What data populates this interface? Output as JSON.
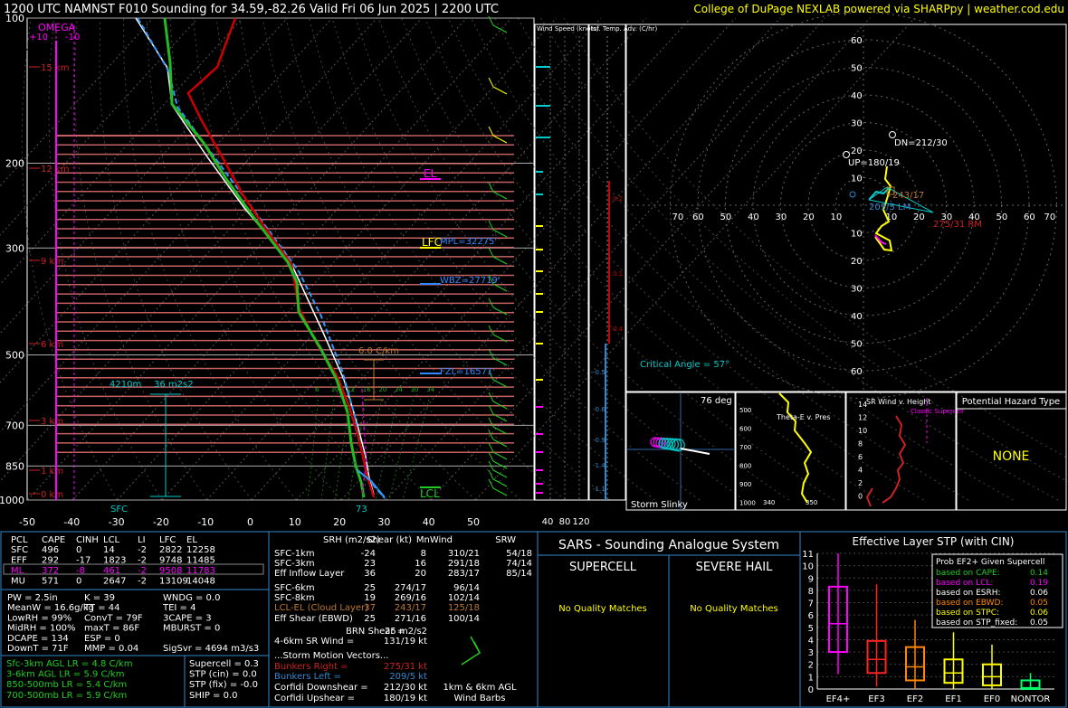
{
  "header": {
    "title": "1200 UTC NAMNST F010 Sounding for 34.59,-82.26 Valid  Fri 06 Jun 2025 | 2200 UTC",
    "credit": "College of DuPage NEXLAB powered via SHARPpy | weather.cod.edu"
  },
  "colors": {
    "bg": "#000000",
    "temp": "#cc0000",
    "dewpoint": "#22bb22",
    "wetbulb": "#00bbff",
    "parcel": "#ffffff",
    "dry_adiabat": "#888888",
    "moist_adiabat": "#22aa22",
    "mixing_ratio": "#22aa22",
    "cape_shade": "#e87070",
    "wind_barb": "#22cc22",
    "accent_cyan": "#00cccc",
    "magenta": "#ff00ff",
    "yellow": "#ffff00",
    "border": "#3388cc"
  },
  "skewt": {
    "omega_label": "OMEGA",
    "omega_ticks": [
      "+10",
      "-10"
    ],
    "pressure_ticks": [
      "100",
      "200",
      "300",
      "500",
      "700",
      "850",
      "1000"
    ],
    "temp_ticks": [
      "-50",
      "-40",
      "-30",
      "-20",
      "-10",
      "0",
      "10",
      "20",
      "30",
      "40",
      "50"
    ],
    "height_labels": [
      "15 km",
      "12 km",
      "9 km",
      "6 km",
      "3 km",
      "1 km",
      "0 km"
    ],
    "el_label": "EL",
    "lfc_label": "LFC",
    "lcl_label": "LCL",
    "mpl_label": "MPL=32275'",
    "wbz_label": "WBZ=27719'",
    "frz_label": "FZL=16571'",
    "lapse_label": "6.0 C/km",
    "dcape_label": "4210m",
    "srh_label": "36 m2s2",
    "sfc_label": "SFC",
    "sfc_temp_label": "73",
    "mixing_labels": [
      "6",
      "10",
      "12",
      "16",
      "20",
      "24",
      "30",
      "34"
    ]
  },
  "wind_speed_panel": {
    "title": "Wind Speed (knots)",
    "ticks": [
      "40",
      "80",
      "120"
    ]
  },
  "inf_temp_panel": {
    "title": "Inf. Temp. Adv. (C/hr)",
    "ticks": [
      "0.2",
      "0.1",
      "0.4",
      "-0.5",
      "-0.6",
      "-0.9",
      "-1.4",
      "-1.1"
    ]
  },
  "hodograph": {
    "ring_labels": [
      "10",
      "20",
      "30",
      "40",
      "50",
      "60",
      "70"
    ],
    "dn_label": "DN=212/30",
    "up_label": "UP=180/19",
    "brm_value": "243/17",
    "lm_label": "209/5 LM",
    "rm_label": "275/31 RM",
    "critical_angle": "Critical Angle = 57°"
  },
  "storm_slinky": {
    "title": "Storm Slinky",
    "deg": "76 deg"
  },
  "theta_e_panel": {
    "title": "Theta-E v. Pres",
    "ticks": [
      "500",
      "600",
      "700",
      "800",
      "900",
      "1000"
    ],
    "x_ticks": [
      "340",
      "350"
    ]
  },
  "sr_wind_panel": {
    "title": "SR Wind v. Height",
    "classic": "Classic Supercell",
    "ticks": [
      "14",
      "12",
      "10",
      "8",
      "6",
      "4",
      "2",
      "0"
    ]
  },
  "hazard": {
    "title": "Potential Hazard Type",
    "value": "NONE"
  },
  "parcels": {
    "headers": [
      "PCL",
      "CAPE",
      "CINH",
      "LCL",
      "LI",
      "LFC",
      "EL"
    ],
    "rows": [
      [
        "SFC",
        "496",
        "0",
        "14",
        "-2",
        "2822",
        "12258"
      ],
      [
        "EFF",
        "292",
        "-17",
        "1823",
        "-2",
        "9748",
        "11485"
      ],
      [
        "ML",
        "372",
        "-8",
        "461",
        "-2",
        "9508",
        "11783"
      ],
      [
        "MU",
        "571",
        "0",
        "2647",
        "-2",
        "13109",
        "14048"
      ]
    ]
  },
  "indices": [
    [
      "PW = 2.5in",
      "K = 39",
      "WNDG = 0.0"
    ],
    [
      "MeanW = 16.6g/kg",
      "TT = 44",
      "TEI = 4"
    ],
    [
      "LowRH = 99%",
      "ConvT = 79F",
      "3CAPE = 3"
    ],
    [
      "MidRH = 100%",
      "maxT = 86F",
      "MBURST = 0"
    ],
    [
      "DCAPE = 134",
      "ESP = 0",
      ""
    ],
    [
      "DownT = 71F",
      "MMP = 0.04",
      "SigSvr = 4694 m3/s3"
    ]
  ],
  "lapse_rates": [
    "Sfc-3km AGL LR = 4.8 C/km",
    "3-6km AGL LR = 5.9 C/km",
    "850-500mb LR = 5.4 C/km",
    "700-500mb LR = 5.9 C/km"
  ],
  "composites": [
    "Supercell = 0.3",
    "STP (cin) = 0.0",
    "STP (fix) = -0.0",
    "SHIP = 0.0"
  ],
  "kinematics": {
    "headers": [
      "SRH (m2/s2)",
      "Shear (kt)",
      "MnWind",
      "SRW"
    ],
    "rows": [
      [
        "SFC-1km",
        "-24",
        "8",
        "310/21",
        "54/18"
      ],
      [
        "SFC-3km",
        "23",
        "16",
        "291/18",
        "74/14"
      ],
      [
        "Eff Inflow Layer",
        "36",
        "20",
        "283/17",
        "85/14"
      ],
      [
        "",
        "",
        "",
        "",
        ""
      ],
      [
        "SFC-6km",
        "25",
        "274/17",
        "96/14",
        ""
      ],
      [
        "SFC-8km",
        "19",
        "269/16",
        "102/14",
        ""
      ],
      [
        "LCL-EL (Cloud Layer)",
        "37",
        "243/17",
        "125/18",
        ""
      ],
      [
        "Eff Shear (EBWD)",
        "25",
        "271/16",
        "100/14",
        ""
      ]
    ],
    "brn_shear": "BRN Shear =",
    "brn_value": "25 m2/s2",
    "srwind_label": "4-6km SR Wind =",
    "srwind_value": "131/19 kt",
    "storm_motion_title": "...Storm Motion Vectors...",
    "bunkers_right": "Bunkers Right =",
    "bunkers_right_value": "275/31 kt",
    "bunkers_left": "Bunkers Left =",
    "bunkers_left_value": "209/5 kt",
    "corfidi_down": "Corfidi Downshear =",
    "corfidi_down_value": "212/30 kt",
    "corfidi_up": "Corfidi Upshear =",
    "corfidi_up_value": "180/19 kt",
    "barb_label_1": "1km & 6km AGL",
    "barb_label_2": "Wind Barbs"
  },
  "sars": {
    "title": "SARS - Sounding Analogue System",
    "supercell": "SUPERCELL",
    "hail": "SEVERE HAIL",
    "supercell_msg": "No Quality Matches",
    "hail_msg": "No Quality Matches"
  },
  "stp": {
    "title": "Effective Layer STP (with CIN)",
    "legend_title": "Prob EF2+ Given Supercell",
    "legend": [
      [
        "based on CAPE:",
        "0.14"
      ],
      [
        "based on LCL:",
        "0.19"
      ],
      [
        "based on ESRH:",
        "0.06"
      ],
      [
        "based on EBWD:",
        "0.05"
      ],
      [
        "based on STPC:",
        "0.06"
      ],
      [
        "based on STP_fixed:",
        "0.05"
      ]
    ],
    "y_ticks": [
      "11",
      "10",
      "9",
      "8",
      "7",
      "6",
      "5",
      "4",
      "3",
      "2",
      "1",
      "0"
    ]
  },
  "chart_data": {
    "type": "box",
    "title": "Effective Layer STP (with CIN)",
    "categories": [
      "EF4+",
      "EF3",
      "EF2",
      "EF1",
      "EF0",
      "NONTOR"
    ],
    "colors": [
      "#ff00ff",
      "#ff2222",
      "#ff8800",
      "#ffff00",
      "#ffff00",
      "#00ff66"
    ],
    "boxes": [
      {
        "whisker_low": 1.2,
        "q1": 3.0,
        "median": 5.3,
        "q3": 8.3,
        "whisker_high": 11.0
      },
      {
        "whisker_low": 0.2,
        "q1": 1.3,
        "median": 2.4,
        "q3": 3.9,
        "whisker_high": 8.5
      },
      {
        "whisker_low": 0.0,
        "q1": 0.7,
        "median": 1.8,
        "q3": 3.4,
        "whisker_high": 5.6
      },
      {
        "whisker_low": 0.0,
        "q1": 0.5,
        "median": 1.3,
        "q3": 2.4,
        "whisker_high": 4.6
      },
      {
        "whisker_low": 0.0,
        "q1": 0.3,
        "median": 1.0,
        "q3": 2.0,
        "whisker_high": 3.6
      },
      {
        "whisker_low": 0.0,
        "q1": 0.0,
        "median": 0.1,
        "q3": 0.7,
        "whisker_high": 1.3
      }
    ],
    "ylim": [
      0,
      11
    ]
  }
}
